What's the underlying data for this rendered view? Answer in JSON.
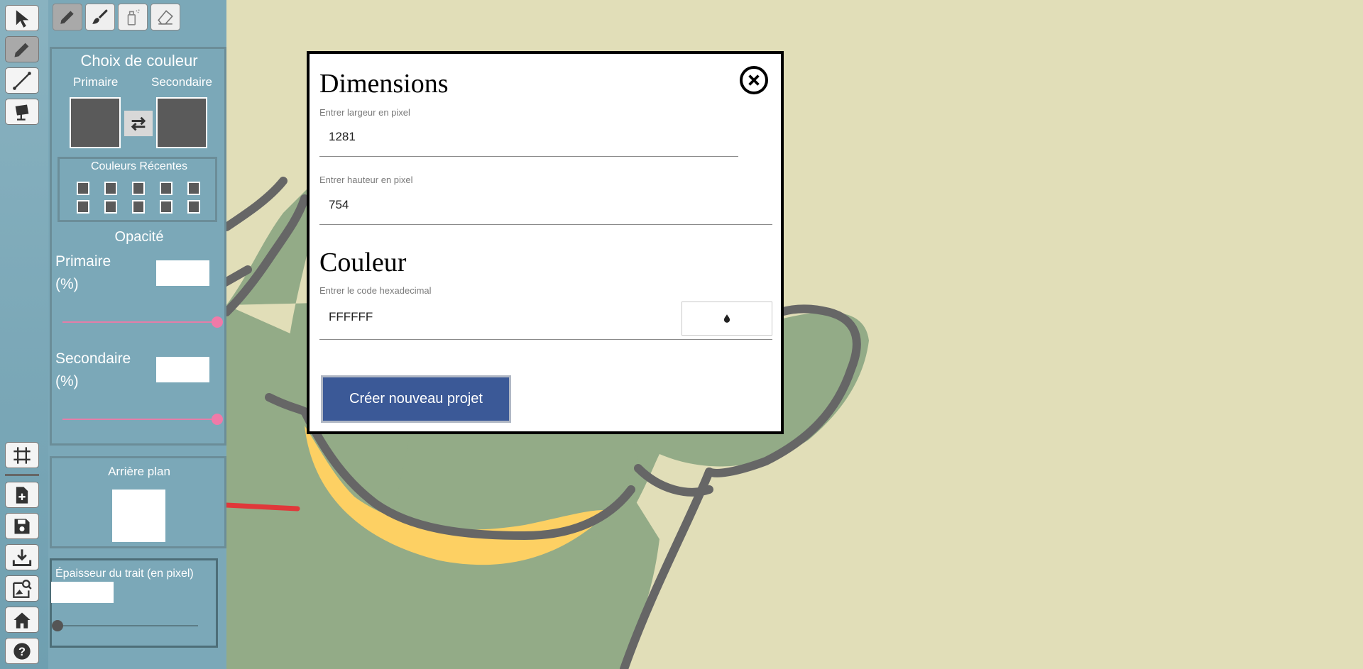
{
  "toolbar": {
    "tools": [
      "select-tool",
      "pencil-tool",
      "line-tool",
      "fill-tool"
    ],
    "actions": [
      "grid-tool",
      "new-project",
      "save",
      "download",
      "image-search",
      "home",
      "help"
    ]
  },
  "subtools": [
    "pencil",
    "brush",
    "spray",
    "eraser"
  ],
  "panel": {
    "color_title": "Choix de couleur",
    "primary_label": "Primaire",
    "secondary_label": "Secondaire",
    "recent_title": "Couleurs Récentes",
    "opacity_title": "Opacité",
    "opacity_primary_label": "Primaire",
    "opacity_secondary_label": "Secondaire",
    "percent_label": "(%)",
    "opacity_primary_value": 100,
    "opacity_secondary_value": 100,
    "background_title": "Arrière plan",
    "thickness_title": "Épaisseur du trait (en pixel)",
    "thickness_value": 0,
    "primary_color": "#5a5a5a",
    "secondary_color": "#5a5a5a",
    "background_color": "#ffffff"
  },
  "modal": {
    "dimensions_title": "Dimensions",
    "width_label": "Entrer largeur en pixel",
    "width_value": "1281",
    "height_label": "Entrer hauteur en pixel",
    "height_value": "754",
    "color_title": "Couleur",
    "hex_label": "Entrer le code hexadecimal",
    "hex_value": "FFFFFF",
    "create_button": "Créer nouveau projet",
    "accent_color": "#3b5997"
  },
  "canvas": {
    "background_color": "#e1deb8",
    "frog_color": "#93ab87",
    "stroke_color": "#666666",
    "mouth_color": "#fdd063",
    "arrow_color": "#e0383a"
  }
}
